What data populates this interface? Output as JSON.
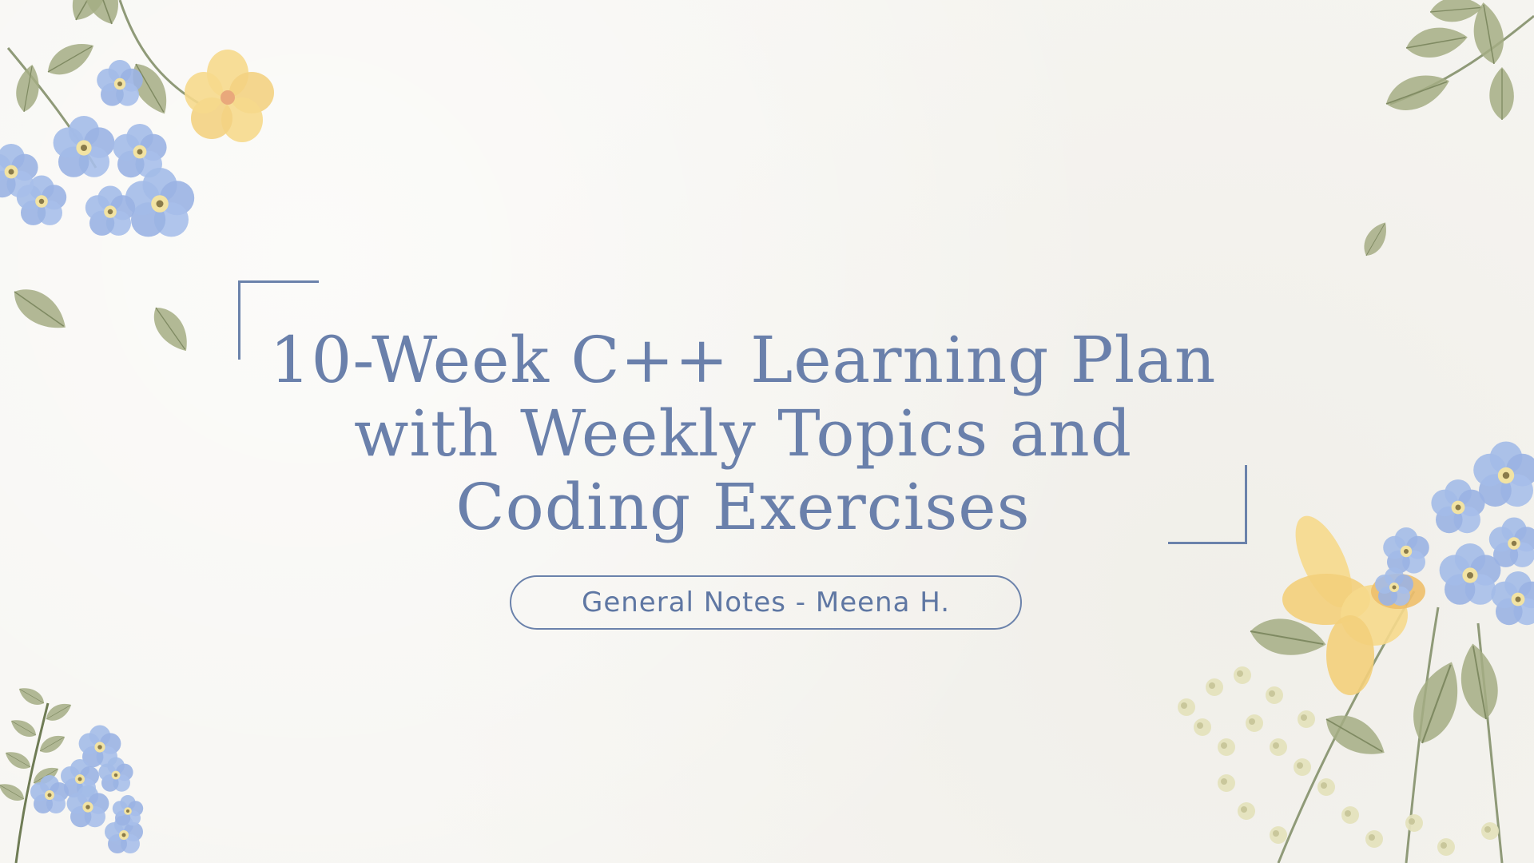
{
  "slide": {
    "title": "10-Week C++ Learning Plan with Weekly Topics and Coding Exercises",
    "subtitle": "General Notes - Meena H."
  },
  "colors": {
    "background": "#f6f5f1",
    "accent": "#6a80ab",
    "flower_blue": "#9db7e6",
    "flower_yellow": "#f5d98a",
    "leaf_green": "#9aa87e"
  },
  "decorations": {
    "top_left": "watercolor-blue-flowers-and-yellow-flower",
    "top_right": "watercolor-olive-leaves",
    "bottom_left": "watercolor-blue-flowers-and-fern",
    "bottom_right": "watercolor-yellow-daffodil-blue-flowers-and-baby-breath",
    "scattered": "falling-leaves"
  }
}
